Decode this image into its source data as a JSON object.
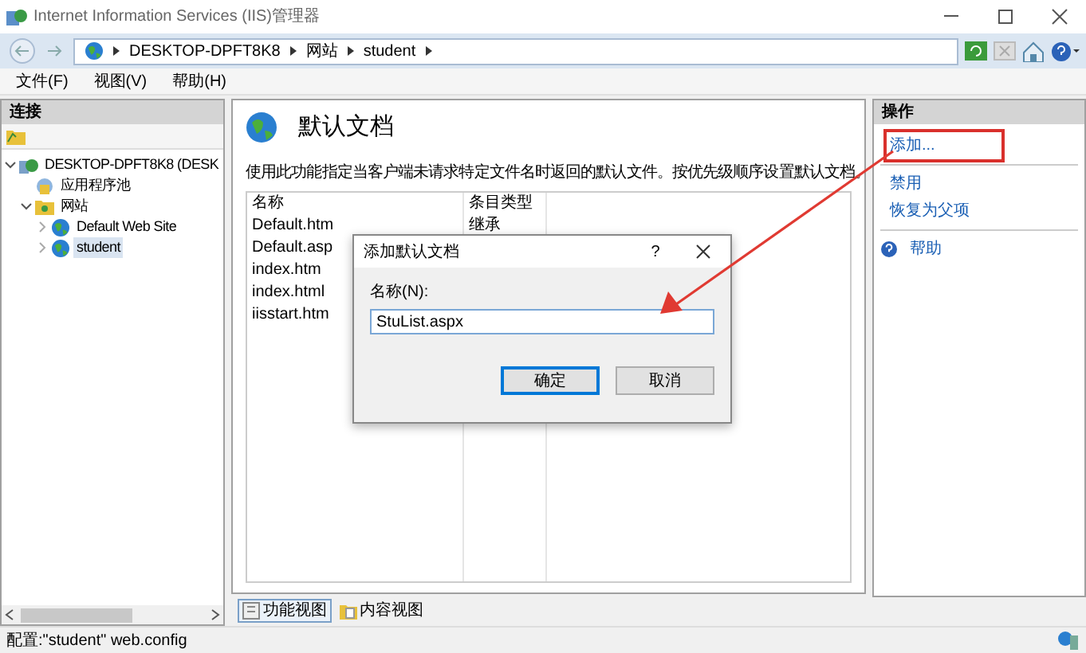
{
  "window": {
    "title": "Internet Information Services (IIS)管理器"
  },
  "address_bar": {
    "path": [
      "DESKTOP-DPFT8K8",
      "网站",
      "student"
    ]
  },
  "menu": [
    "文件(F)",
    "视图(V)",
    "帮助(H)"
  ],
  "connections": {
    "title": "连接",
    "tree": [
      {
        "label": "DESKTOP-DPFT8K8 (DESK",
        "kind": "server",
        "expanded": true,
        "selected": false,
        "children": [
          {
            "label": "应用程序池",
            "kind": "pool",
            "selected": false
          },
          {
            "label": "网站",
            "kind": "folder",
            "expanded": true,
            "selected": false,
            "children": [
              {
                "label": "Default Web Site",
                "kind": "site",
                "expanded": false,
                "selected": false
              },
              {
                "label": "student",
                "kind": "site",
                "expanded": false,
                "selected": true
              }
            ]
          }
        ]
      }
    ]
  },
  "feature": {
    "title": "默认文档",
    "description": "使用此功能指定当客户端未请求特定文件名时返回的默认文件。按优先级顺序设置默认文档。",
    "columns": [
      "名称",
      "条目类型"
    ],
    "rows": [
      {
        "name": "Default.htm",
        "type": "继承"
      },
      {
        "name": "Default.asp"
      },
      {
        "name": "index.htm"
      },
      {
        "name": "index.html"
      },
      {
        "name": "iisstart.htm"
      }
    ]
  },
  "view_tabs": [
    {
      "label": "功能视图",
      "selected": true
    },
    {
      "label": "内容视图",
      "selected": false
    }
  ],
  "actions": {
    "title": "操作",
    "groups": [
      [
        {
          "label": "添加...",
          "kind": "link",
          "highlighted": true
        }
      ],
      [
        {
          "label": "禁用",
          "kind": "link",
          "highlighted": false
        },
        {
          "label": "恢复为父项",
          "kind": "link",
          "highlighted": false
        }
      ],
      [
        {
          "label": "帮助",
          "kind": "help",
          "highlighted": false
        }
      ]
    ]
  },
  "dialog": {
    "title": "添加默认文档",
    "help": "?",
    "field_label": "名称(N):",
    "value": "StuList.aspx",
    "buttons": [
      {
        "label": "确定",
        "default": true
      },
      {
        "label": "取消",
        "default": false
      }
    ]
  },
  "status_bar": "配置:\"student\" web.config"
}
